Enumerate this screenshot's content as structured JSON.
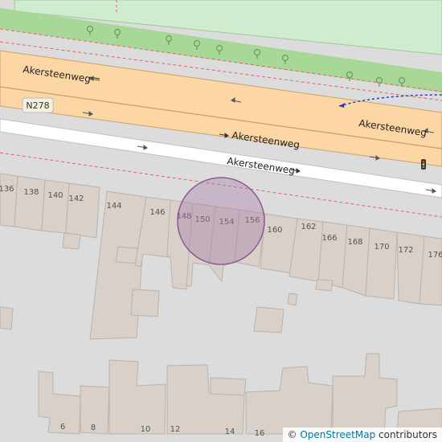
{
  "map": {
    "streets": [
      {
        "name": "Akersteenweg"
      },
      {
        "name": "Akersteenweg"
      },
      {
        "name": "Akersteenweg"
      }
    ],
    "road_ref": "N278",
    "house_numbers": [
      "136",
      "138",
      "140",
      "142",
      "144",
      "146",
      "148",
      "150",
      "154",
      "156",
      "160",
      "162",
      "166",
      "168",
      "170",
      "172",
      "176",
      "6",
      "8",
      "10",
      "12",
      "14",
      "16"
    ],
    "colors": {
      "background": "#dcdcdc",
      "park": "#cfeccf",
      "grass": "#a8d898",
      "primary_road": "#fcd6a4",
      "road_casing": "#c8a070",
      "minor_road": "#ffffff",
      "building": "#d8d0c9",
      "building_outline": "#bcb3aa",
      "boundary": "#e06666",
      "highlight_fill": "#a47ea8",
      "highlight_stroke": "#8a5c8e",
      "path": "#2040c0"
    },
    "highlight_label": "location-circle"
  },
  "attribution": {
    "symbol": "©",
    "link_text": "OpenStreetMap",
    "suffix": "contributors"
  }
}
